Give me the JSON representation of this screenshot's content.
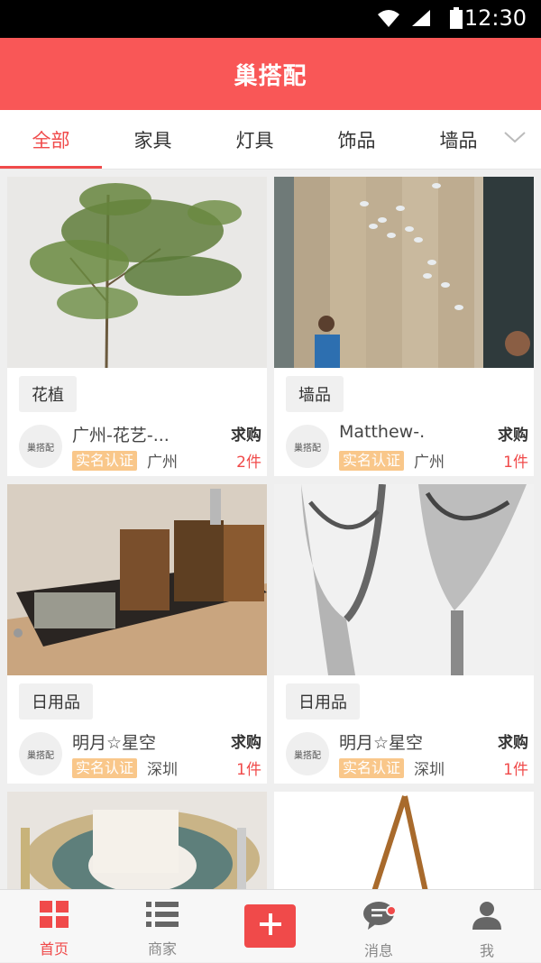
{
  "status_bar": {
    "time": "12:30"
  },
  "header": {
    "title": "巢搭配"
  },
  "tabs": [
    {
      "label": "全部"
    },
    {
      "label": "家具"
    },
    {
      "label": "灯具"
    },
    {
      "label": "饰品"
    },
    {
      "label": "墙品"
    }
  ],
  "cards": [
    {
      "tag": "花植",
      "avatar_text": "巢搭配",
      "name": "广州-花艺-...",
      "badge": "实名认证",
      "city": "广州",
      "type": "求购",
      "count": "2件"
    },
    {
      "tag": "墙品",
      "avatar_text": "巢搭配",
      "name": "Matthew-.",
      "badge": "实名认证",
      "city": "广州",
      "type": "求购",
      "count": "1件"
    },
    {
      "tag": "日用品",
      "avatar_text": "巢搭配",
      "name": "明月☆星空",
      "badge": "实名认证",
      "city": "深圳",
      "type": "求购",
      "count": "1件"
    },
    {
      "tag": "日用品",
      "avatar_text": "巢搭配",
      "name": "明月☆星空",
      "badge": "实名认证",
      "city": "深圳",
      "type": "求购",
      "count": "1件"
    }
  ],
  "bottom_nav": {
    "home": "首页",
    "merchants": "商家",
    "messages": "消息",
    "me": "我"
  },
  "colors": {
    "brand": "#f95757",
    "accent": "#f04a4a",
    "badge": "#f9c78a"
  }
}
